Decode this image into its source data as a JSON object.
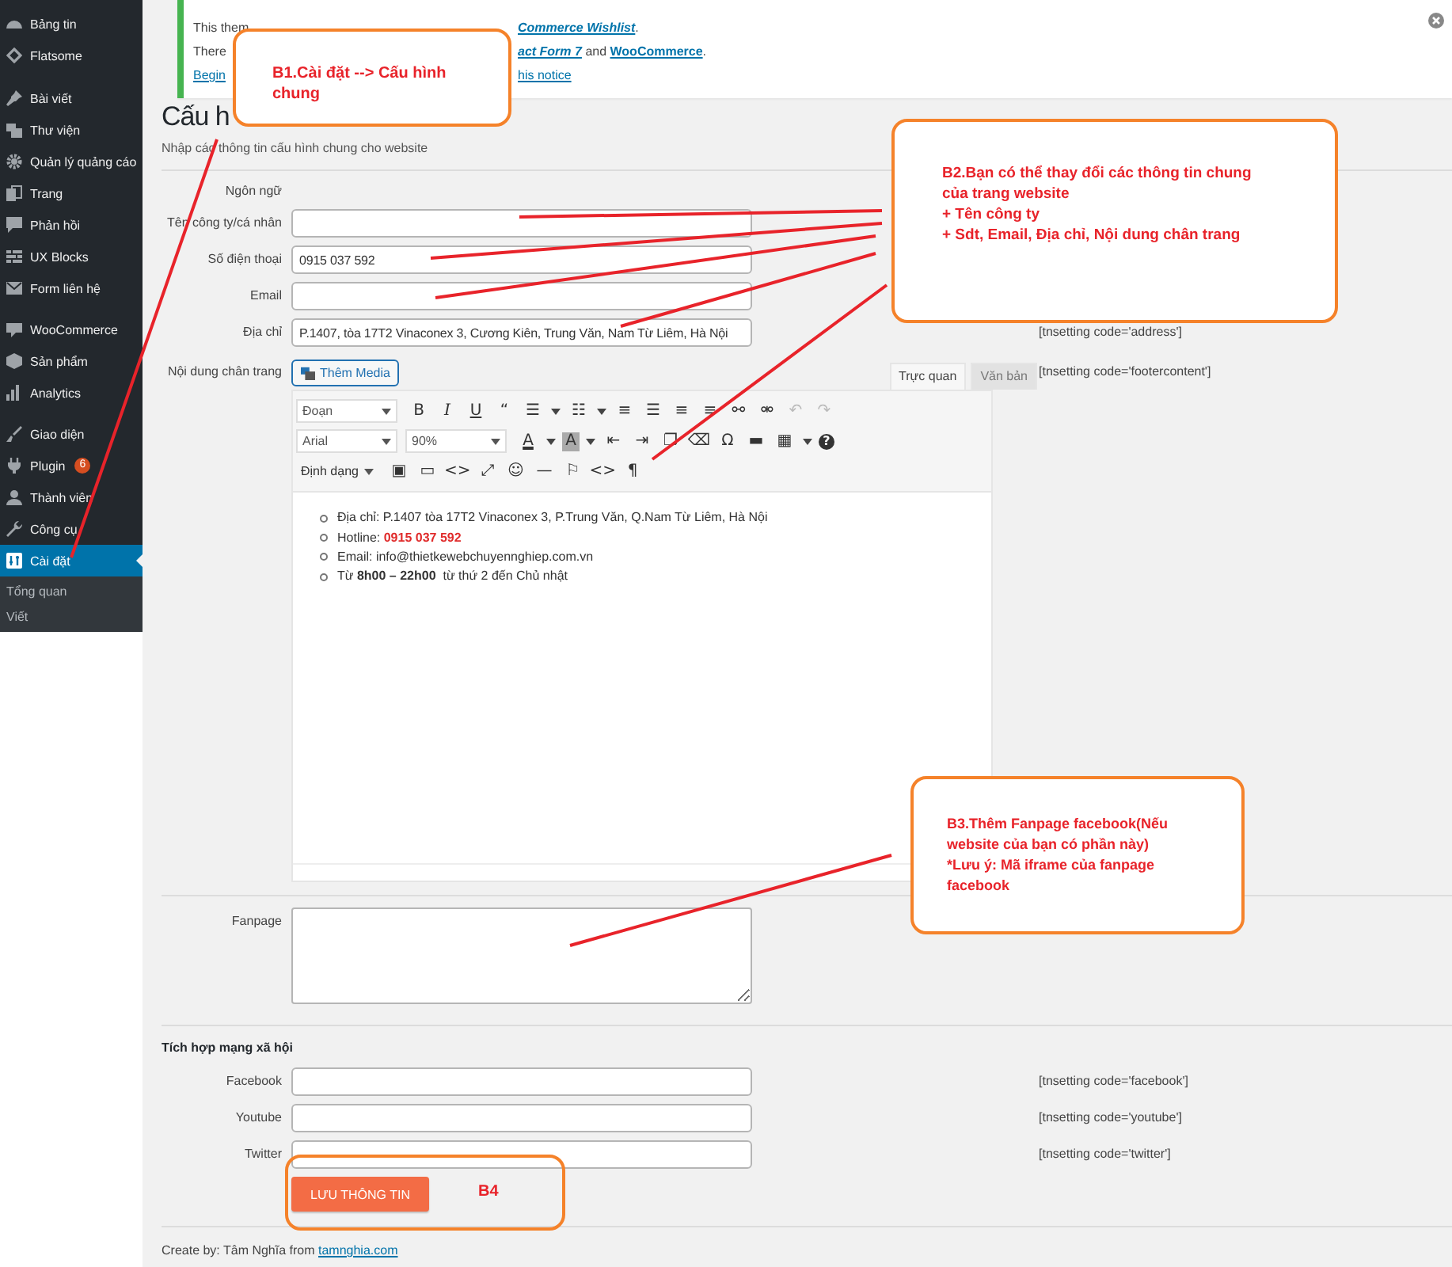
{
  "sidebar": {
    "menu_groups": [
      [
        {
          "label": "Bảng tin",
          "selected": false
        },
        {
          "label": "Flatsome",
          "selected": false
        }
      ],
      [
        {
          "label": "Bài viết",
          "selected": false
        },
        {
          "label": "Thư viện",
          "selected": false
        },
        {
          "label": "Quản lý quảng cáo",
          "selected": false
        },
        {
          "label": "Trang",
          "selected": false
        },
        {
          "label": "Phản hồi",
          "selected": false
        },
        {
          "label": "UX Blocks",
          "selected": false
        },
        {
          "label": "Form liên hệ",
          "selected": false
        }
      ],
      [
        {
          "label": "WooCommerce",
          "selected": false
        },
        {
          "label": "Sản phẩm",
          "selected": false
        },
        {
          "label": "Analytics",
          "selected": false
        }
      ],
      [
        {
          "label": "Giao diện",
          "selected": false
        },
        {
          "label": "Plugin",
          "selected": false,
          "badge": "6"
        },
        {
          "label": "Thành viên",
          "selected": false
        },
        {
          "label": "Công cụ",
          "selected": false
        },
        {
          "label": "Cài đặt",
          "selected": true,
          "children": [
            {
              "label": "Tổng quan",
              "selected": false
            },
            {
              "label": "Viết",
              "selected": false
            }
          ]
        }
      ]
    ]
  },
  "notice": {
    "lines": [
      {
        "left": [
          {
            "text": "This them",
            "kind": "plain"
          }
        ],
        "right": [
          {
            "text": "Commerce Wishlist",
            "kind": "strong-link"
          },
          {
            "text": ".",
            "kind": "plain"
          }
        ]
      },
      {
        "left": [
          {
            "text": "There",
            "kind": "plain"
          }
        ],
        "right": [
          {
            "text": "act Form 7",
            "kind": "strong-link"
          },
          {
            "text": " and ",
            "kind": "plain"
          },
          {
            "text": "WooCommerce",
            "kind": "bold-link"
          },
          {
            "text": ".",
            "kind": "plain"
          }
        ]
      },
      {
        "left": [
          {
            "text": "Begin",
            "kind": "link"
          }
        ],
        "right": [
          {
            "text": "his notice",
            "kind": "link"
          }
        ]
      }
    ]
  },
  "page": {
    "title": "Cấu h",
    "subtitle": "Nhập các thông tin cấu hình chung cho website"
  },
  "form": {
    "fields": [
      {
        "kind": "label-only",
        "label": "Ngôn ngữ"
      },
      {
        "kind": "text",
        "label": "Tên công ty/cá nhân"
      },
      {
        "kind": "text",
        "label": "Số điện thoại",
        "value": "0915 037 592"
      },
      {
        "kind": "text",
        "label": "Email"
      },
      {
        "kind": "text",
        "label": "Địa chỉ",
        "value": "P.1407, tòa 17T2 Vinaconex 3, Cương Kiên, Trung Văn, Nam Từ Liêm, Hà Nội",
        "note": "[tnsetting code='address']"
      },
      {
        "kind": "editor",
        "label": "Nội dung chân trang",
        "note": "[tnsetting code='footercontent']"
      },
      {
        "kind": "textarea",
        "label": "Fanpage"
      }
    ]
  },
  "editor": {
    "media_button": "Thêm Media",
    "tabs": [
      {
        "label": "Trực quan",
        "selected": true
      },
      {
        "label": "Văn bản",
        "selected": false
      }
    ],
    "toolbar": [
      [
        {
          "kind": "select",
          "text": "Đoạn"
        },
        {
          "kind": "button",
          "text": "B",
          "disabled": false
        },
        {
          "kind": "italic",
          "text": "I",
          "disabled": false
        },
        {
          "kind": "underline",
          "text": "U",
          "disabled": false
        },
        {
          "kind": "button",
          "text": "“",
          "disabled": false
        },
        {
          "kind": "button",
          "text": "☰",
          "disabled": false
        },
        {
          "kind": "caret",
          "disabled": false
        },
        {
          "kind": "button",
          "text": "☷",
          "disabled": false
        },
        {
          "kind": "caret",
          "disabled": false
        },
        {
          "kind": "button",
          "text": "≡",
          "disabled": false
        },
        {
          "kind": "button",
          "text": "☰",
          "disabled": false
        },
        {
          "kind": "button",
          "text": "≡",
          "disabled": false
        },
        {
          "kind": "button",
          "text": "≡",
          "disabled": false
        },
        {
          "kind": "button",
          "text": "⚯",
          "disabled": false
        },
        {
          "kind": "button",
          "text": "⚮",
          "disabled": false
        },
        {
          "kind": "button",
          "text": "↶",
          "disabled": true
        },
        {
          "kind": "button",
          "text": "↷",
          "disabled": true
        }
      ],
      [
        {
          "kind": "select",
          "text": "Arial"
        },
        {
          "kind": "select",
          "text": "90%"
        },
        {
          "kind": "color",
          "text": "A",
          "disabled": false
        },
        {
          "kind": "caret",
          "disabled": false
        },
        {
          "kind": "highlight",
          "text": "A",
          "disabled": false
        },
        {
          "kind": "caret",
          "disabled": false
        },
        {
          "kind": "button",
          "text": "⇤",
          "disabled": false
        },
        {
          "kind": "button",
          "text": "⇥",
          "disabled": false
        },
        {
          "kind": "button",
          "text": "❐",
          "disabled": false
        },
        {
          "kind": "button",
          "text": "⌫",
          "disabled": false
        },
        {
          "kind": "button",
          "text": "Ω",
          "disabled": false
        },
        {
          "kind": "button",
          "text": "▬",
          "disabled": false
        },
        {
          "kind": "button",
          "text": "▦",
          "disabled": false
        },
        {
          "kind": "caret",
          "disabled": false
        },
        {
          "kind": "help",
          "text": "?",
          "disabled": false
        }
      ],
      [
        {
          "kind": "menu",
          "text": "Định dạng"
        },
        {
          "kind": "button",
          "text": "▣",
          "disabled": false
        },
        {
          "kind": "button",
          "text": "▭",
          "disabled": false
        },
        {
          "kind": "button",
          "text": "<>",
          "disabled": false
        },
        {
          "kind": "button",
          "text": "⤢",
          "disabled": false
        },
        {
          "kind": "button",
          "text": "☺",
          "disabled": false
        },
        {
          "kind": "button",
          "text": "—",
          "disabled": false
        },
        {
          "kind": "button",
          "text": "⚐",
          "disabled": false
        },
        {
          "kind": "button",
          "text": "<>",
          "disabled": false
        },
        {
          "kind": "button",
          "text": "¶",
          "disabled": false
        }
      ]
    ],
    "content": [
      {
        "text": "Địa chỉ: P.1407 tòa 17T2 Vinaconex 3, P.Trung Văn, Q.Nam Từ Liêm, Hà Nội"
      },
      {
        "text": "Hotline: ",
        "highlight": "0915 037 592"
      },
      {
        "text": "Email: info@thietkewebchuyennghiep.com.vn"
      },
      {
        "text": "Từ **8h00 – 22h00**  từ thứ 2 đến Chủ nhật"
      }
    ]
  },
  "social": {
    "heading": "Tích hợp mạng xã hội",
    "fields": [
      {
        "label": "Facebook",
        "note": "[tnsetting code='facebook']"
      },
      {
        "label": "Youtube",
        "note": "[tnsetting code='youtube']"
      },
      {
        "label": "Twitter",
        "note": "[tnsetting code='twitter']"
      }
    ]
  },
  "save_button": "LƯU THÔNG TIN",
  "footer": {
    "text": "Create by: Tâm Nghĩa from ",
    "link": "tamnghia.com"
  },
  "callouts": [
    {
      "kind": "box",
      "lines": [
        "B1.Cài đặt --> Cấu hình chung"
      ]
    },
    {
      "kind": "box",
      "lines": [
        "B2.Bạn có thể thay đổi các thông tin chung",
        "của trang website",
        "+ Tên công ty",
        "+ Sdt, Email, Địa chỉ, Nội dung chân trang"
      ]
    },
    {
      "kind": "box",
      "lines": [
        "B3.Thêm Fanpage facebook(Nếu",
        "website của bạn có phần này)",
        "*Lưu ý: Mã iframe của fanpage",
        "facebook"
      ]
    },
    {
      "kind": "frame",
      "lines": [
        "B4"
      ]
    }
  ]
}
